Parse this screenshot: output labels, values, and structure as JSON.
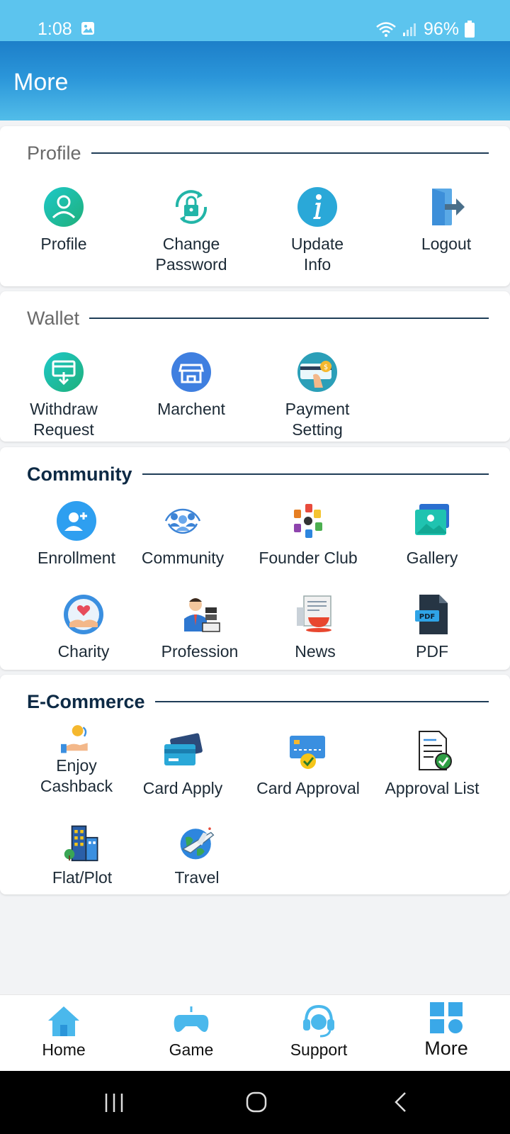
{
  "status_bar": {
    "time": "1:08",
    "battery": "96%"
  },
  "header": {
    "title": "More"
  },
  "sections": {
    "profile": {
      "title": "Profile",
      "items": [
        {
          "label": "Profile",
          "icon": "user-icon"
        },
        {
          "label": "Change\nPassword",
          "icon": "lock-refresh-icon"
        },
        {
          "label": "Update\nInfo",
          "icon": "info-icon"
        },
        {
          "label": "Logout",
          "icon": "logout-door-icon"
        }
      ]
    },
    "wallet": {
      "title": "Wallet",
      "items": [
        {
          "label": "Withdraw\nRequest",
          "icon": "withdraw-icon"
        },
        {
          "label": "Marchent",
          "icon": "store-icon"
        },
        {
          "label": "Payment\nSetting",
          "icon": "payment-setting-icon"
        }
      ]
    },
    "community": {
      "title": "Community",
      "items": [
        {
          "label": "Enrollment",
          "icon": "add-user-icon"
        },
        {
          "label": "Community",
          "icon": "community-group-icon"
        },
        {
          "label": "Founder Club",
          "icon": "founder-club-icon"
        },
        {
          "label": "Gallery",
          "icon": "gallery-icon"
        },
        {
          "label": "Charity",
          "icon": "charity-icon"
        },
        {
          "label": "Profession",
          "icon": "profession-icon"
        },
        {
          "label": "News",
          "icon": "news-icon"
        },
        {
          "label": "PDF",
          "icon": "pdf-icon"
        }
      ]
    },
    "ecommerce": {
      "title": "E-Commerce",
      "items": [
        {
          "label": "Enjoy\nCashback",
          "icon": "cashback-icon"
        },
        {
          "label": "Card Apply",
          "icon": "card-apply-icon"
        },
        {
          "label": "Card Approval",
          "icon": "card-approval-icon"
        },
        {
          "label": "Approval List",
          "icon": "approval-list-icon"
        },
        {
          "label": "Flat/Plot",
          "icon": "building-icon"
        },
        {
          "label": "Travel",
          "icon": "travel-icon"
        }
      ]
    }
  },
  "bottom_nav": {
    "items": [
      {
        "label": "Home",
        "icon": "home-icon"
      },
      {
        "label": "Game",
        "icon": "gamepad-icon"
      },
      {
        "label": "Support",
        "icon": "headset-icon"
      },
      {
        "label": "More",
        "icon": "grid-icon",
        "active": true
      }
    ]
  },
  "colors": {
    "accent": "#2a95d9",
    "icon_blue": "#3fa9e0",
    "heading_dark": "#0d2a45"
  }
}
